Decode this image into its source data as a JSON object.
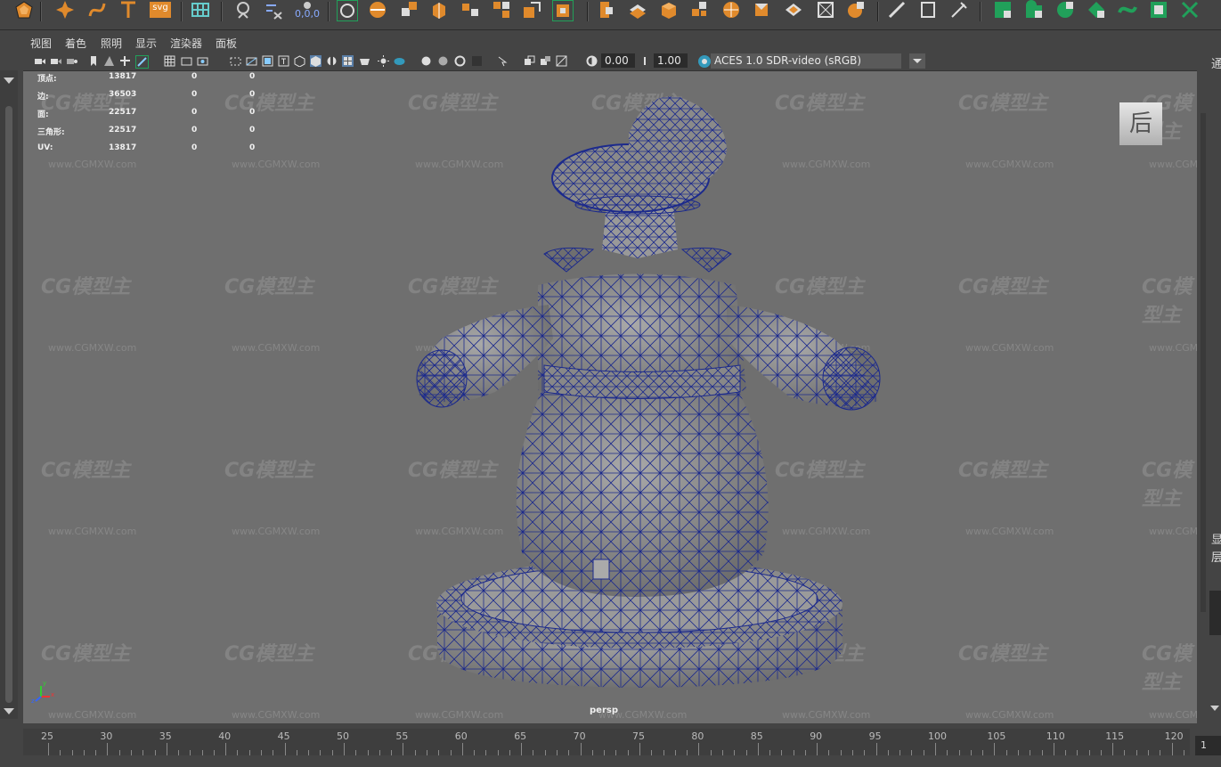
{
  "shelf": {
    "coord_label": "0,0,0",
    "svg_label": "svg",
    "icons": [
      "sculpt-sphere-icon",
      "paint-star-icon",
      "curve-tool-icon",
      "text-tool-icon",
      "svg-tool-icon",
      "grid-tool-icon",
      "lasso-select-icon",
      "multi-cut-icon",
      "snap-together-icon",
      "quad-draw-icon",
      "bevel-icon",
      "append-polygon-icon",
      "extrude-icon",
      "bridge-icon",
      "combine-icon",
      "separate-icon",
      "smooth-icon",
      "boolean-icon",
      "mirror-icon",
      "cube-create-icon",
      "sphere-create-icon",
      "cylinder-create-icon",
      "plane-create-icon",
      "torus-create-icon",
      "target-weld-icon",
      "pencil-icon",
      "ruler-icon",
      "wand-icon",
      "uv-unfold-icon",
      "uv-layout-icon",
      "uv-shell-icon",
      "uv-cut-icon",
      "uv-sew-icon",
      "uv-checker-icon",
      "uv-x-icon"
    ]
  },
  "menu": {
    "items": [
      "视图",
      "着色",
      "照明",
      "显示",
      "渲染器",
      "面板"
    ]
  },
  "panel_toolbar": {
    "exposure_value": "0.00",
    "gamma_value": "1.00",
    "color_management": "ACES 1.0 SDR-video (sRGB)"
  },
  "hud": {
    "rows": [
      {
        "label": "顶点:",
        "value": "13817",
        "sel": "0",
        "comp": "0"
      },
      {
        "label": "边:",
        "value": "36503",
        "sel": "0",
        "comp": "0"
      },
      {
        "label": "面:",
        "value": "22517",
        "sel": "0",
        "comp": "0"
      },
      {
        "label": "三角形:",
        "value": "22517",
        "sel": "0",
        "comp": "0"
      },
      {
        "label": "UV:",
        "value": "13817",
        "sel": "0",
        "comp": "0"
      }
    ]
  },
  "viewport": {
    "camera": "persp",
    "viewcube_face": "后",
    "watermark_logo": "CG模型主",
    "watermark_url": "www.CGMXW.com",
    "axis_labels": [
      "x",
      "y",
      "z"
    ]
  },
  "right_panel": {
    "top_char": "通",
    "mid_chars": [
      "显",
      "层"
    ]
  },
  "timeline": {
    "ticks": [
      "25",
      "30",
      "35",
      "40",
      "45",
      "50",
      "55",
      "60",
      "65",
      "70",
      "75",
      "80",
      "85",
      "90",
      "95",
      "100",
      "105",
      "110",
      "115",
      "120"
    ],
    "current_frame": "1"
  },
  "colors": {
    "wire": "#1c2a8c",
    "shelf_green": "#21a05a",
    "shelf_orange": "#e08a2c",
    "viewport_bg": "#6f6f6f"
  }
}
